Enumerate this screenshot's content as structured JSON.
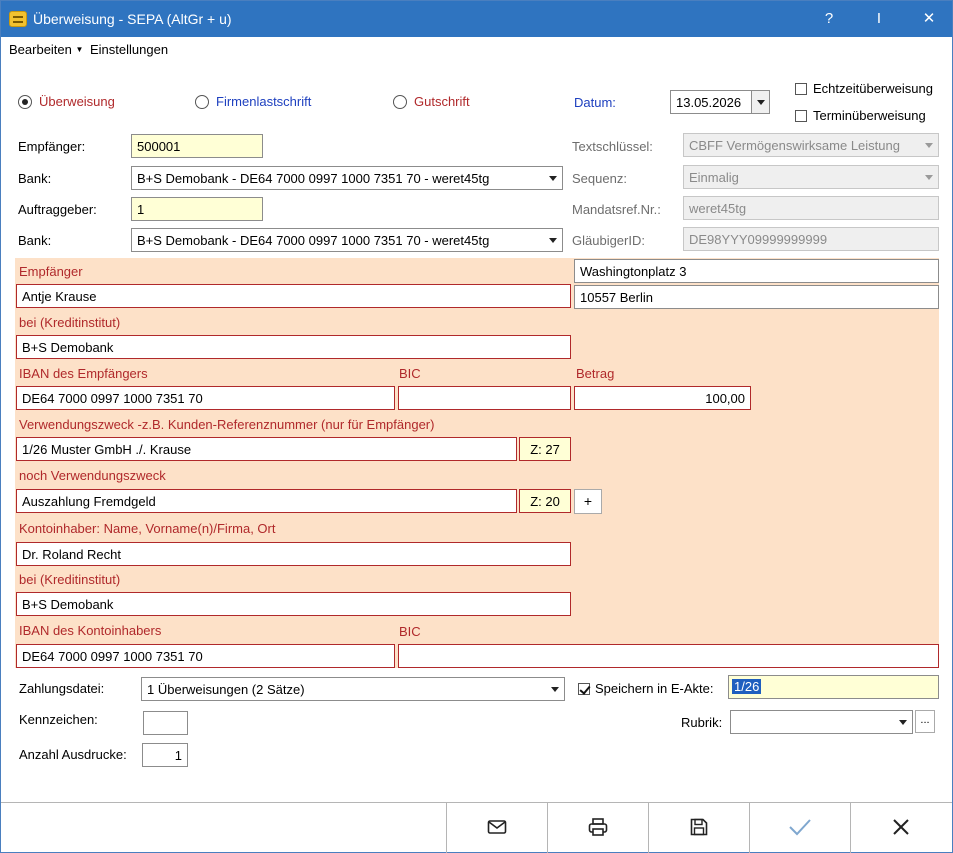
{
  "window": {
    "title": "Überweisung - SEPA (AltGr + u)",
    "help": "?",
    "pin": "I",
    "close": "✕"
  },
  "menu": {
    "edit": "Bearbeiten",
    "settings": "Einstellungen"
  },
  "type": {
    "transfer": "Überweisung",
    "company_debit": "Firmenlastschrift",
    "credit": "Gutschrift"
  },
  "date": {
    "label": "Datum:",
    "value": "13.05.2026"
  },
  "options": {
    "realtime": "Echtzeitüberweisung",
    "scheduled": "Terminüberweisung"
  },
  "left": {
    "recipient_label": "Empfänger:",
    "recipient_value": "500001",
    "bank_label": "Bank:",
    "bank_value": "B+S Demobank  -  DE64 7000 0997 1000 7351 70  -  weret45tg",
    "client_label": "Auftraggeber:",
    "client_value": "1",
    "bank2_label": "Bank:",
    "bank2_value": "B+S Demobank  -  DE64 7000 0997 1000 7351 70  -  weret45tg"
  },
  "right": {
    "textkey_label": "Textschlüssel:",
    "textkey_value": "CBFF Vermögenswirksame Leistung",
    "sequence_label": "Sequenz:",
    "sequence_value": "Einmalig",
    "mandate_label": "Mandatsref.Nr.:",
    "mandate_value": "weret45tg",
    "creditor_label": "GläubigerID:",
    "creditor_value": "DE98YYY09999999999"
  },
  "panel": {
    "recipient_label": "Empfänger",
    "recipient_name": "Antje Krause",
    "street": "Washingtonplatz 3",
    "city": "10557 Berlin",
    "at_bank_label": "bei (Kreditinstitut)",
    "at_bank_value": "B+S Demobank",
    "iban_label": "IBAN des Empfängers",
    "iban_value": "DE64 7000 0997 1000 7351 70",
    "bic_label": "BIC",
    "bic_value": "",
    "amount_label": "Betrag",
    "amount_value": "100,00",
    "purpose_label": "Verwendungszweck -z.B. Kunden-Referenznummer (nur für Empfänger)",
    "purpose_value": "1/26 Muster GmbH ./. Krause",
    "purpose_count": "Z: 27",
    "purpose2_label": "noch Verwendungszweck",
    "purpose2_value": "Auszahlung Fremdgeld",
    "purpose2_count": "Z: 20",
    "add_label": "+",
    "holder_label": "Kontoinhaber: Name, Vorname(n)/Firma, Ort",
    "holder_value": "Dr. Roland Recht",
    "holder_bank_label": "bei (Kreditinstitut)",
    "holder_bank_value": "B+S Demobank",
    "holder_iban_label": "IBAN des Kontoinhabers",
    "holder_iban_value": "DE64 7000 0997 1000 7351 70",
    "holder_bic_label": "BIC",
    "holder_bic_value": ""
  },
  "bottom": {
    "file_label": "Zahlungsdatei:",
    "file_value": "1  Überweisungen  (2 Sätze)",
    "save_label": "Speichern in E-Akte:",
    "save_value": "1/26",
    "mark_label": "Kennzeichen:",
    "mark_value": "",
    "rubric_label": "Rubrik:",
    "rubric_value": "",
    "rubric_more": "...",
    "prints_label": "Anzahl Ausdrucke:",
    "prints_value": "1"
  },
  "footer": {
    "icons": [
      "mail-icon",
      "print-icon",
      "save-icon",
      "check-icon",
      "close-icon"
    ]
  }
}
